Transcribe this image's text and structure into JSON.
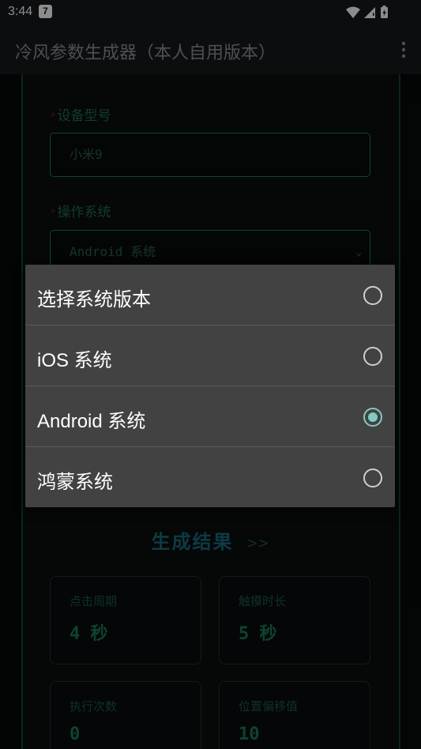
{
  "status_bar": {
    "time": "3:44",
    "badge": "7",
    "icons": [
      "wifi-icon",
      "signal-icon",
      "battery-icon"
    ]
  },
  "app_bar": {
    "title": "冷风参数生成器（本人自用版本）",
    "menu_icon": "more-vert-icon"
  },
  "form": {
    "device_label": "设备型号",
    "device_value": "小米9",
    "os_label": "操作系统",
    "os_value": "Android 系统",
    "required_mark": "*"
  },
  "results": {
    "title": "生成结果",
    "arrows": ">>",
    "cards": [
      {
        "label": "点击周期",
        "value": "4 秒"
      },
      {
        "label": "触摸时长",
        "value": "5 秒"
      },
      {
        "label": "执行次数",
        "value": "0"
      },
      {
        "label": "位置偏移值",
        "value": "10"
      }
    ]
  },
  "dialog": {
    "options": [
      {
        "label": "选择系统版本",
        "selected": false
      },
      {
        "label": "iOS 系统",
        "selected": false
      },
      {
        "label": "Android 系统",
        "selected": true
      },
      {
        "label": "鸿蒙系统",
        "selected": false
      }
    ]
  },
  "colors": {
    "accent_radio": "#80cbc4",
    "dialog_bg": "#424242",
    "neon_green": "#1b7d5d",
    "app_bar_bg": "#17191c"
  }
}
